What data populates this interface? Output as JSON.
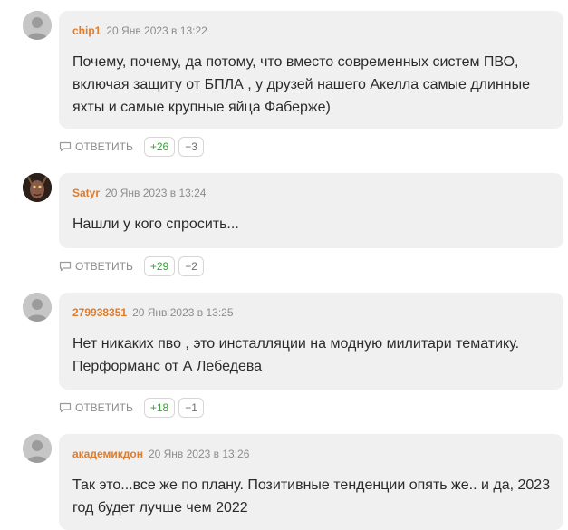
{
  "comments": [
    {
      "author": "chip1",
      "date": "20 Янв 2023 в 13:22",
      "text": "Почему, почему, да потому, что вместо современных систем ПВО, включая защиту от БПЛА , у друзей нашего Акелла самые длинные яхты и самые крупные яйца Фаберже)",
      "reply_label": "ОТВЕТИТЬ",
      "up": "+26",
      "down": "−3"
    },
    {
      "author": "Satyr",
      "date": "20 Янв 2023 в 13:24",
      "text": "Нашли у кого спросить...",
      "reply_label": "ОТВЕТИТЬ",
      "up": "+29",
      "down": "−2"
    },
    {
      "author": "279938351",
      "date": "20 Янв 2023 в 13:25",
      "text": "Нет никаких пво , это инсталляции на модную милитари тематику. Перформанс от А Лебедева",
      "reply_label": "ОТВЕТИТЬ",
      "up": "+18",
      "down": "−1"
    },
    {
      "author": "академикдон",
      "date": "20 Янв 2023 в 13:26",
      "text": "Так это...все же по плану. Позитивные тенденции опять же.. и да, 2023 год будет лучше чем 2022"
    }
  ],
  "icons": {
    "default_avatar": "user-silhouette-icon",
    "satyr_avatar": "satyr-mask-icon",
    "reply": "speech-bubble-icon"
  },
  "colors": {
    "author": "#e07b2a",
    "bubble_bg": "#f0f0f0",
    "upvote": "#3a9e3a",
    "meta_gray": "#8c8c8c"
  }
}
